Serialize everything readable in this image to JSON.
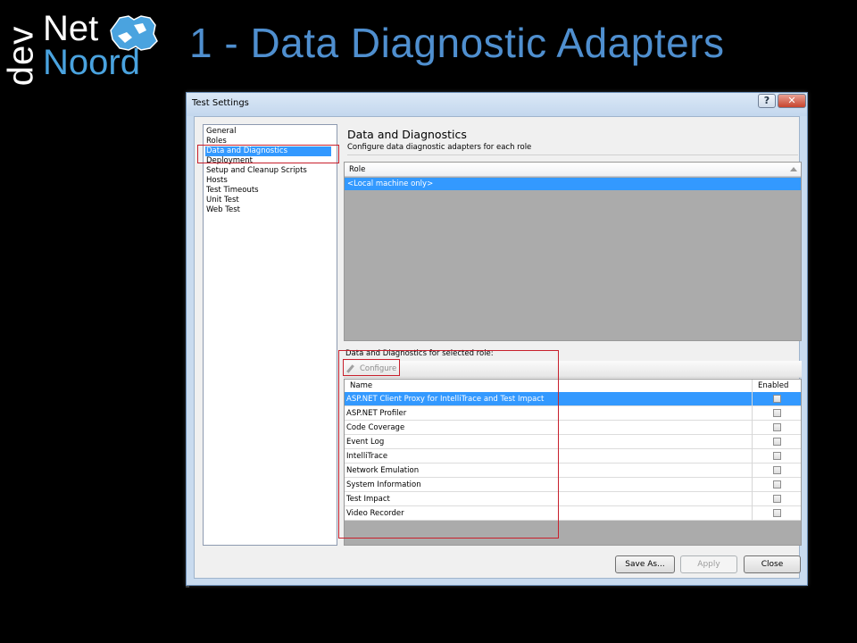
{
  "logo": {
    "dev": "dev",
    "net": "Net",
    "noord": "Noord"
  },
  "slide": {
    "title": "1 - Data Diagnostic Adapters"
  },
  "window": {
    "title": "Test Settings",
    "help_label": "?",
    "close_label": "✕"
  },
  "nav": {
    "items": [
      {
        "label": "General",
        "selected": false
      },
      {
        "label": "Roles",
        "selected": false
      },
      {
        "label": "Data and Diagnostics",
        "selected": true
      },
      {
        "label": "Deployment",
        "selected": false
      },
      {
        "label": "Setup and Cleanup Scripts",
        "selected": false
      },
      {
        "label": "Hosts",
        "selected": false
      },
      {
        "label": "Test Timeouts",
        "selected": false
      },
      {
        "label": "Unit Test",
        "selected": false
      },
      {
        "label": "Web Test",
        "selected": false
      }
    ]
  },
  "main": {
    "heading": "Data and Diagnostics",
    "subheading": "Configure data diagnostic adapters for each role",
    "role_grid": {
      "column": "Role",
      "rows": [
        "<Local machine only>"
      ]
    },
    "selected_role_label": "Data and Diagnostics for selected role:",
    "configure_label": "Configure",
    "adapters": {
      "columns": {
        "name": "Name",
        "enabled": "Enabled"
      },
      "rows": [
        {
          "name": "ASP.NET Client Proxy for IntelliTrace and Test Impact",
          "enabled": false,
          "selected": true
        },
        {
          "name": "ASP.NET Profiler",
          "enabled": false,
          "selected": false
        },
        {
          "name": "Code Coverage",
          "enabled": false,
          "selected": false
        },
        {
          "name": "Event Log",
          "enabled": false,
          "selected": false
        },
        {
          "name": "IntelliTrace",
          "enabled": false,
          "selected": false
        },
        {
          "name": "Network Emulation",
          "enabled": false,
          "selected": false
        },
        {
          "name": "System Information",
          "enabled": false,
          "selected": false
        },
        {
          "name": "Test Impact",
          "enabled": false,
          "selected": false
        },
        {
          "name": "Video Recorder",
          "enabled": false,
          "selected": false
        }
      ]
    }
  },
  "buttons": {
    "save_as": "Save As...",
    "apply": "Apply",
    "close": "Close"
  },
  "colors": {
    "accent": "#3399ff",
    "highlight_border": "#c8202c",
    "title_blue": "#4f8fcf"
  }
}
